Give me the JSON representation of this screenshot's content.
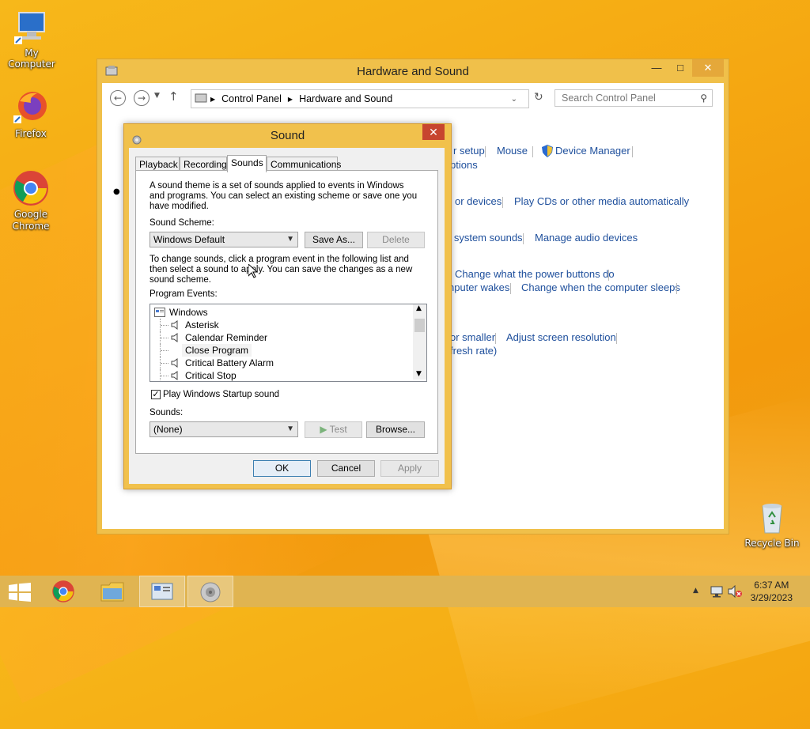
{
  "desktop": {
    "icons": [
      {
        "label": "My Computer"
      },
      {
        "label": "Firefox"
      },
      {
        "label": "Google Chrome"
      },
      {
        "label": "Recycle Bin"
      }
    ]
  },
  "control_panel": {
    "title": "Hardware and Sound",
    "breadcrumb": [
      "Control Panel",
      "Hardware and Sound"
    ],
    "search_placeholder": "Search Control Panel",
    "links": {
      "setup": "r setup",
      "mouse": "Mouse",
      "device_manager": "Device Manager",
      "options": "ptions",
      "or_devices": "or devices",
      "play_cds": "Play CDs or other media automatically",
      "system_sounds": "e system sounds",
      "manage_audio": "Manage audio devices",
      "power_buttons": "Change what the power buttons do",
      "computer_wakes": "nputer wakes",
      "computer_sleeps": "Change when the computer sleeps",
      "or_smaller": "or smaller",
      "adjust_resolution": "Adjust screen resolution",
      "refresh_rate": "fresh rate)"
    }
  },
  "sound_dialog": {
    "title": "Sound",
    "tabs": [
      "Playback",
      "Recording",
      "Sounds",
      "Communications"
    ],
    "active_tab": "Sounds",
    "intro_text": [
      "A sound theme is a set of sounds applied to events in Windows",
      "and programs.  You can select an existing scheme or save one you",
      "have modified."
    ],
    "scheme_label": "Sound Scheme:",
    "scheme_value": "Windows Default",
    "save_as": "Save As...",
    "delete": "Delete",
    "instructions": [
      "To change sounds, click a program event in the following list and",
      "then select a sound to apply.  You can save the changes as a new",
      "sound scheme."
    ],
    "program_events_label": "Program Events:",
    "events": [
      {
        "label": "Windows",
        "group": true
      },
      {
        "label": "Asterisk"
      },
      {
        "label": "Calendar Reminder"
      },
      {
        "label": "Close Program"
      },
      {
        "label": "Critical Battery Alarm"
      },
      {
        "label": "Critical Stop"
      }
    ],
    "startup_checkbox": "Play Windows Startup sound",
    "startup_checked": true,
    "sounds_label": "Sounds:",
    "sound_value": "(None)",
    "test": "Test",
    "browse": "Browse...",
    "ok": "OK",
    "cancel": "Cancel",
    "apply": "Apply"
  },
  "taskbar": {
    "time": "6:37 AM",
    "date": "3/29/2023"
  }
}
